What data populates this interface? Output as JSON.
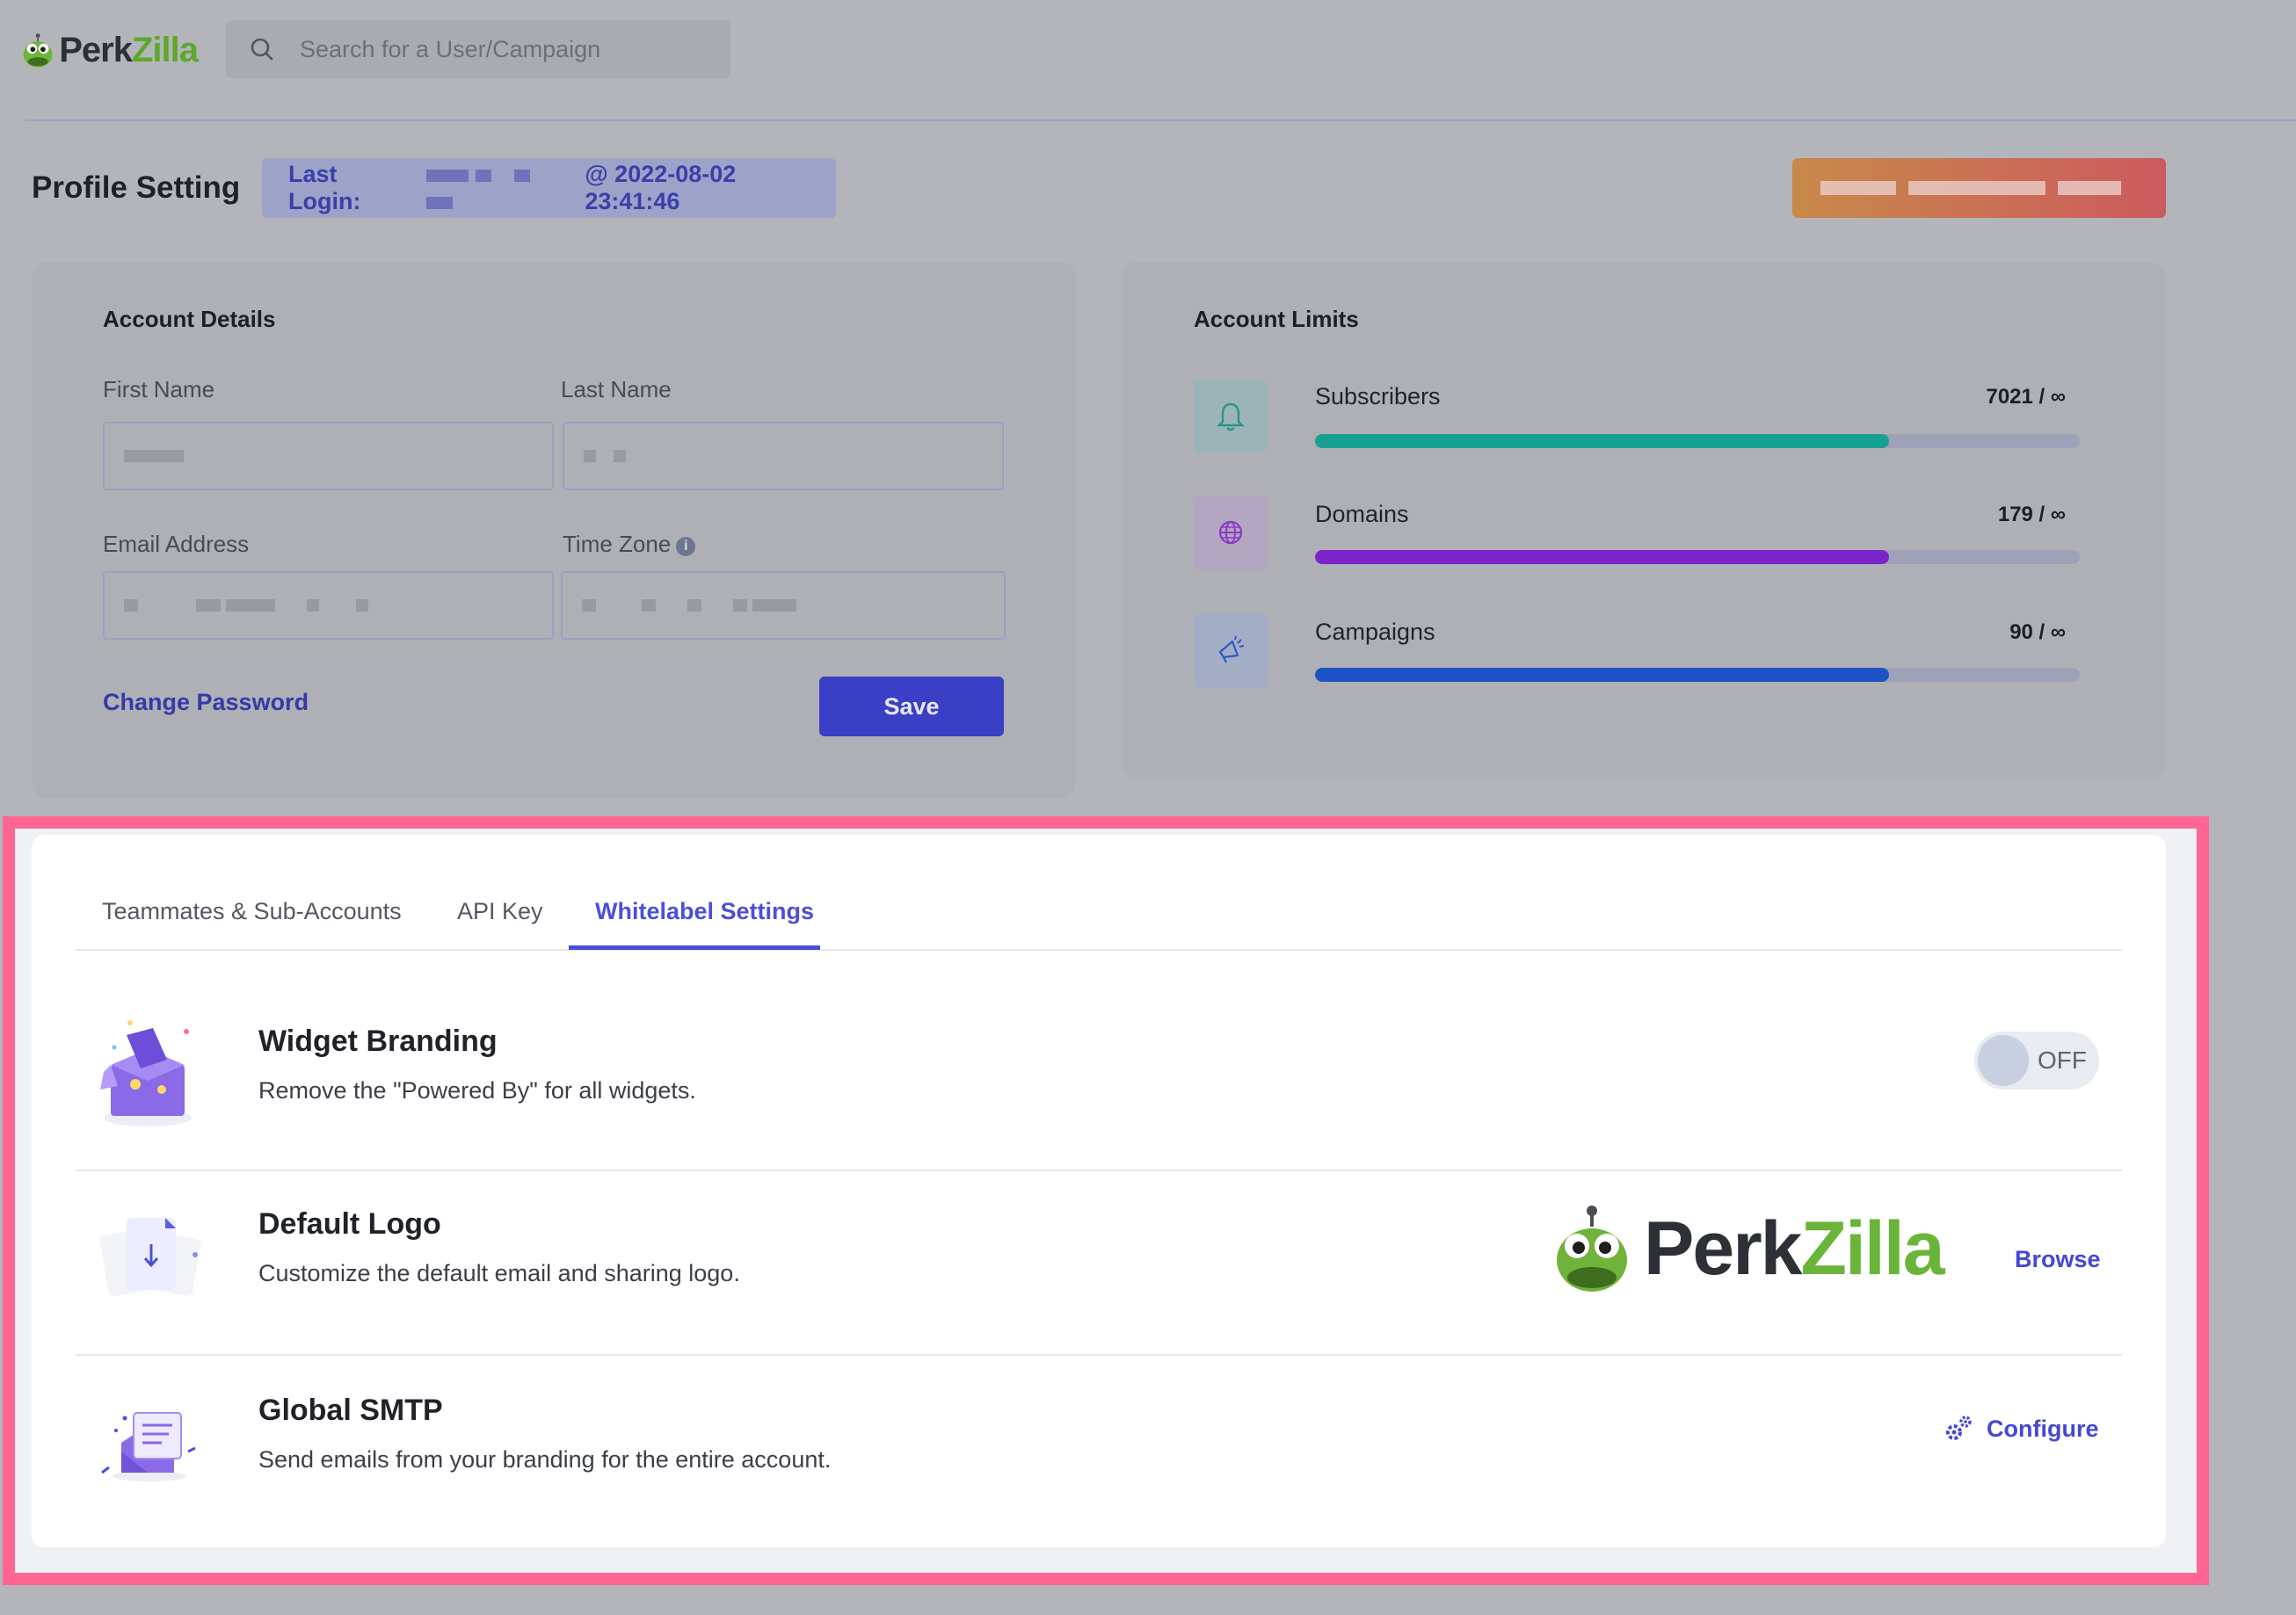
{
  "header": {
    "logo_perk": "Perk",
    "logo_zilla": "Zilla",
    "search_placeholder": "Search for a User/Campaign"
  },
  "page": {
    "title": "Profile Setting",
    "last_login_label": "Last Login:",
    "last_login_suffix": "@ 2022-08-02 23:41:46"
  },
  "account_details": {
    "title": "Account Details",
    "first_name_label": "First Name",
    "last_name_label": "Last Name",
    "email_label": "Email Address",
    "timezone_label": "Time Zone",
    "info_glyph": "i",
    "change_password": "Change Password",
    "save": "Save"
  },
  "account_limits": {
    "title": "Account Limits",
    "items": [
      {
        "name": "Subscribers",
        "value": "7021 / ∞",
        "fill_fraction": 0.75,
        "color": "#16a08f",
        "icon": "bell-icon"
      },
      {
        "name": "Domains",
        "value": "179 / ∞",
        "fill_fraction": 0.75,
        "color": "#7b24c9",
        "icon": "globe-icon"
      },
      {
        "name": "Campaigns",
        "value": "90 / ∞",
        "fill_fraction": 0.75,
        "color": "#1d53c4",
        "icon": "megaphone-icon"
      }
    ]
  },
  "tabs": [
    {
      "label": "Teammates & Sub-Accounts",
      "active": false
    },
    {
      "label": "API Key",
      "active": false
    },
    {
      "label": "Whitelabel Settings",
      "active": true
    }
  ],
  "whitelabel": {
    "widget_branding": {
      "title": "Widget Branding",
      "description": "Remove the \"Powered By\" for all widgets.",
      "toggle_state": "OFF"
    },
    "default_logo": {
      "title": "Default Logo",
      "description": "Customize the default email and sharing logo.",
      "logo_perk": "Perk",
      "logo_zilla": "Zilla",
      "action": "Browse"
    },
    "global_smtp": {
      "title": "Global SMTP",
      "description": "Send emails from your branding for the entire account.",
      "action": "Configure"
    }
  },
  "colors": {
    "accent": "#4b4fd8",
    "highlight_border": "#ff6694",
    "brand_green": "#5ea82c"
  }
}
